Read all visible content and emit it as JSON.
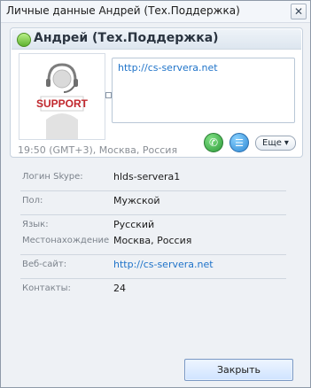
{
  "window": {
    "title": "Личные данные Андрей (Тех.Поддержка)",
    "close_glyph": "✕"
  },
  "profile": {
    "name": "Андрей (Тех.Поддержка)",
    "mood_link": "http://cs-servera.net",
    "local_time": "19:50 (GMT+3), Москва, Россия",
    "avatar_text": "SUPPORT",
    "actions": {
      "more_label": "Еще",
      "more_caret": "▾",
      "call_glyph": "✆",
      "chat_glyph": "☰"
    }
  },
  "details": [
    {
      "label": "Логин Skype:",
      "value": "hlds-servera1",
      "is_link": false
    },
    {
      "label": "Пол:",
      "value": "Мужской",
      "is_link": false
    },
    {
      "label": "Язык:",
      "value": "Русский",
      "is_link": false
    },
    {
      "label": "Местонахождение",
      "value": "Москва, Россия",
      "is_link": false
    },
    {
      "label": "Веб-сайт:",
      "value": "http://cs-servera.net",
      "is_link": true
    },
    {
      "label": "Контакты:",
      "value": "24",
      "is_link": false
    }
  ],
  "footer": {
    "close_label": "Закрыть"
  },
  "colors": {
    "link": "#1f73c9",
    "online": "#5fb22e",
    "call": "#2f9a3b",
    "chat": "#2e88d3"
  },
  "icons": {
    "status": "online-status-icon",
    "call": "call-icon",
    "chat": "chat-icon",
    "close": "close-icon"
  }
}
